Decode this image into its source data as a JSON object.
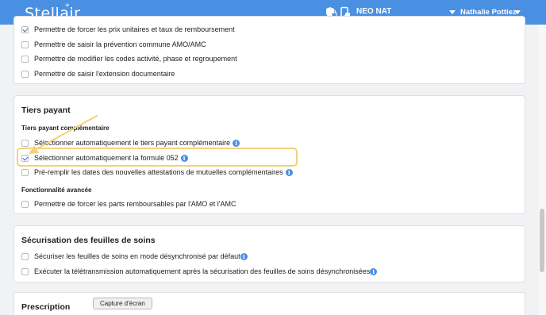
{
  "app": {
    "logo": "Stellair",
    "center_name": "NEO NAT",
    "user_name": "Nathalie Pottiez"
  },
  "header_icons": [
    "shield-lock-icon",
    "mobile-device-icon"
  ],
  "section_top": {
    "items": [
      {
        "label": "Permettre de forcer les prix unitaires et taux de remboursement",
        "checked": true
      },
      {
        "label": "Permettre de saisir la prévention commune AMO/AMC",
        "checked": false
      },
      {
        "label": "Permettre de modifier les codes activité, phase et regroupement",
        "checked": false
      },
      {
        "label": "Permettre de saisir l'extension documentaire",
        "checked": false
      }
    ]
  },
  "section_tiers": {
    "title": "Tiers payant",
    "sub1": "Tiers payant complémentaire",
    "items": [
      {
        "label": "Sélectionner automatiquement le tiers payant complémentaire",
        "checked": false
      },
      {
        "label": "Sélectionner automatiquement la formule 052",
        "checked": true
      },
      {
        "label": "Pré-remplir les dates des nouvelles attestations de mutuelles complémentaires",
        "checked": false
      }
    ],
    "sub2": "Fonctionnalité avancée",
    "advanced": {
      "label": "Permettre de forcer les parts remboursables par l'AMO et l'AMC",
      "checked": false
    }
  },
  "section_secu": {
    "title": "Sécurisation des feuilles de soins",
    "items": [
      {
        "label": "Sécuriser les feuilles de soins en mode désynchronisé par défaut",
        "checked": false
      },
      {
        "label": "Exécuter la télétransmission automatiquement après la sécurisation des feuilles de soins désynchronisées",
        "checked": false
      }
    ]
  },
  "section_prescription": {
    "title": "Prescription"
  },
  "tooltip": "Capture d'écran",
  "colors": {
    "header": "#4a90e2",
    "highlight": "#f3d27a",
    "arrow": "#f3d27a",
    "info": "#4a90e2"
  }
}
